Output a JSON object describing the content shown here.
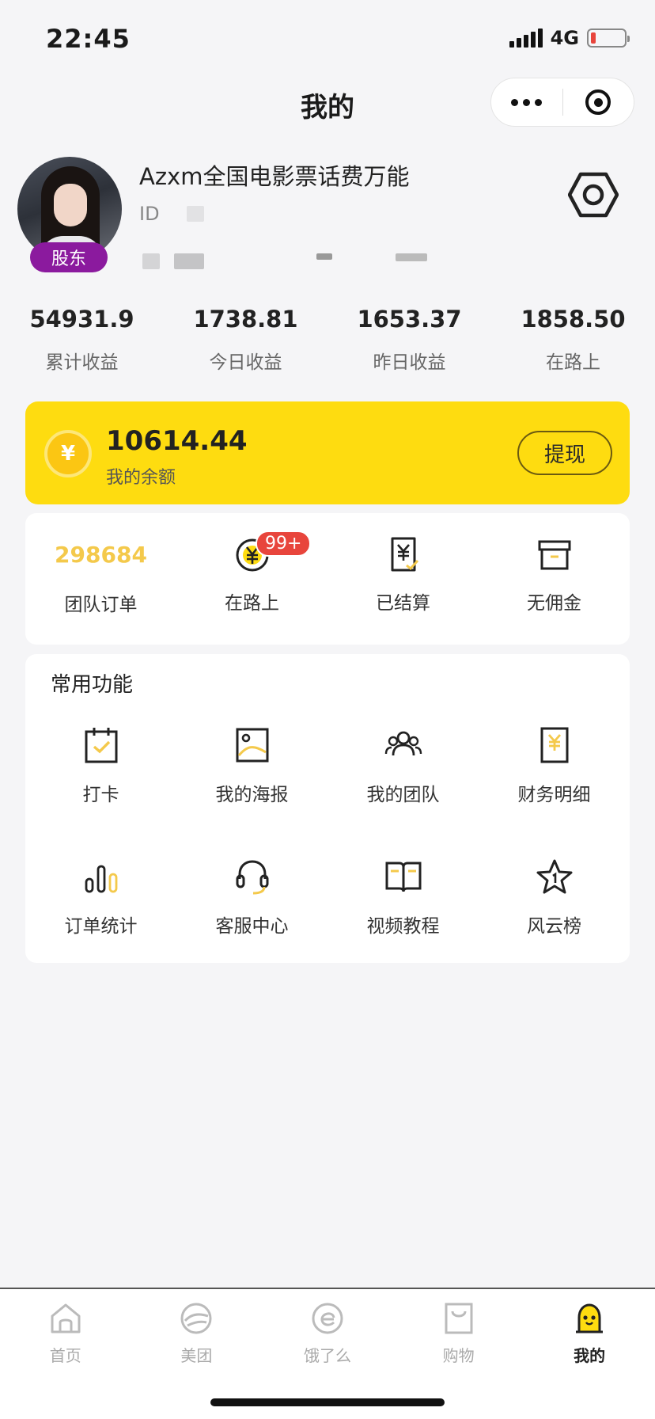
{
  "status_bar": {
    "time": "22:45",
    "network": "4G"
  },
  "nav": {
    "title": "我的"
  },
  "profile": {
    "name": "Azxm全国电影票话费万能",
    "id_prefix": "ID",
    "badge": "股东"
  },
  "stats": [
    {
      "value": "54931.9",
      "label": "累计收益"
    },
    {
      "value": "1738.81",
      "label": "今日收益"
    },
    {
      "value": "1653.37",
      "label": "昨日收益"
    },
    {
      "value": "1858.50",
      "label": "在路上"
    }
  ],
  "balance": {
    "value": "10614.44",
    "label": "我的余额",
    "button": "提现",
    "coin_symbol": "¥"
  },
  "orders": {
    "team": {
      "count": "298684",
      "label": "团队订单"
    },
    "in_transit": {
      "label": "在路上",
      "badge": "99+"
    },
    "settled": {
      "label": "已结算"
    },
    "no_commission": {
      "label": "无佣金"
    }
  },
  "functions": {
    "title": "常用功能",
    "items": [
      {
        "label": "打卡",
        "icon": "calendar-check-icon"
      },
      {
        "label": "我的海报",
        "icon": "image-icon"
      },
      {
        "label": "我的团队",
        "icon": "team-icon"
      },
      {
        "label": "财务明细",
        "icon": "finance-icon"
      },
      {
        "label": "订单统计",
        "icon": "bar-chart-icon"
      },
      {
        "label": "客服中心",
        "icon": "headset-icon"
      },
      {
        "label": "视频教程",
        "icon": "book-icon"
      },
      {
        "label": "风云榜",
        "icon": "star-icon"
      }
    ]
  },
  "tabs": [
    {
      "label": "首页",
      "icon": "home-icon"
    },
    {
      "label": "美团",
      "icon": "meituan-icon"
    },
    {
      "label": "饿了么",
      "icon": "eleme-icon"
    },
    {
      "label": "购物",
      "icon": "shopping-icon"
    },
    {
      "label": "我的",
      "icon": "profile-face-icon",
      "active": true
    }
  ],
  "colors": {
    "accent": "#fedc10",
    "badge_purple": "#8b1a9e",
    "badge_red": "#e8453c",
    "team_count": "#f4c94b"
  }
}
